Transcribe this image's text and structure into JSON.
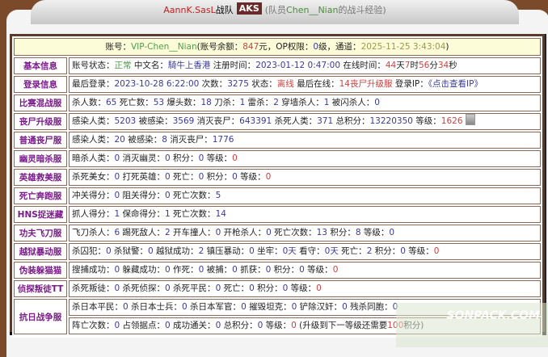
{
  "header": {
    "team": "AannK.SasL",
    "team_suffix": "战队",
    "logo": "AKS",
    "member_prefix": "(队员",
    "member": "Chen__Nian",
    "member_suffix": "的战斗经验)"
  },
  "account_line": [
    {
      "t": "账号：",
      "c": "k"
    },
    {
      "t": "VIP-Chen__Nian",
      "c": "g"
    },
    {
      "t": "(账号余额：",
      "c": "k"
    },
    {
      "t": "847",
      "c": "r"
    },
    {
      "t": "元，OP权限：",
      "c": "k"
    },
    {
      "t": "0",
      "c": "b"
    },
    {
      "t": "级，通道：",
      "c": "k"
    },
    {
      "t": "2025-11-25 3:43:04",
      "c": "o"
    },
    {
      "t": ")",
      "c": "k"
    }
  ],
  "rows": [
    {
      "label": "基本信息",
      "lines": [
        [
          {
            "t": "账号状态：",
            "c": "k"
          },
          {
            "t": "正常",
            "c": "g"
          },
          {
            "t": " 中文名：",
            "c": "k"
          },
          {
            "t": "騎牛上香港",
            "c": "b"
          },
          {
            "t": " 注册时间：",
            "c": "k"
          },
          {
            "t": "2023-01-12 0:47:00",
            "c": "b"
          },
          {
            "t": " 在线时间：",
            "c": "k"
          },
          {
            "t": "44",
            "c": "r"
          },
          {
            "t": "天",
            "c": "k"
          },
          {
            "t": "7",
            "c": "r"
          },
          {
            "t": "时",
            "c": "k"
          },
          {
            "t": "56",
            "c": "r"
          },
          {
            "t": "分",
            "c": "k"
          },
          {
            "t": "34",
            "c": "r"
          },
          {
            "t": "秒",
            "c": "k"
          }
        ]
      ]
    },
    {
      "label": "登录信息",
      "lines": [
        [
          {
            "t": "最后登录：",
            "c": "k"
          },
          {
            "t": "2023-10-28 6:22:00",
            "c": "b"
          },
          {
            "t": " 次数：",
            "c": "k"
          },
          {
            "t": "3275",
            "c": "b"
          },
          {
            "t": " 状态：",
            "c": "k"
          },
          {
            "t": "离线",
            "c": "r"
          },
          {
            "t": " 最后在线：",
            "c": "k"
          },
          {
            "t": "14丧尸升级服",
            "c": "r"
          },
          {
            "t": " 登录IP：",
            "c": "k"
          },
          {
            "t": "《点击查看IP》",
            "c": "b"
          }
        ]
      ]
    },
    {
      "label": "比赛混战服",
      "lines": [
        [
          {
            "t": "杀人数：",
            "c": "k"
          },
          {
            "t": "65",
            "c": "b"
          },
          {
            "t": " 死亡数：",
            "c": "k"
          },
          {
            "t": "53",
            "c": "b"
          },
          {
            "t": " 爆头数：",
            "c": "k"
          },
          {
            "t": "18",
            "c": "b"
          },
          {
            "t": " 刀杀：",
            "c": "k"
          },
          {
            "t": "1",
            "c": "b"
          },
          {
            "t": " 雷杀：",
            "c": "k"
          },
          {
            "t": "2",
            "c": "b"
          },
          {
            "t": " 穿墙杀人：",
            "c": "k"
          },
          {
            "t": "1",
            "c": "b"
          },
          {
            "t": " 被闪杀人：",
            "c": "k"
          },
          {
            "t": "0",
            "c": "b"
          }
        ]
      ]
    },
    {
      "label": "丧尸升级服",
      "avatar": true,
      "lines": [
        [
          {
            "t": "感染人类：",
            "c": "k"
          },
          {
            "t": "5203",
            "c": "b"
          },
          {
            "t": " 被感染：",
            "c": "k"
          },
          {
            "t": "3569",
            "c": "b"
          },
          {
            "t": " 消灭丧尸：",
            "c": "k"
          },
          {
            "t": "643391",
            "c": "b"
          },
          {
            "t": " 杀死人类：",
            "c": "k"
          },
          {
            "t": "371",
            "c": "b"
          },
          {
            "t": " 总积分：",
            "c": "k"
          },
          {
            "t": "13220350",
            "c": "b"
          },
          {
            "t": " 等级：",
            "c": "k"
          },
          {
            "t": "1626",
            "c": "r"
          }
        ]
      ]
    },
    {
      "label": "普通丧尸服",
      "lines": [
        [
          {
            "t": "感染人类：",
            "c": "k"
          },
          {
            "t": "20",
            "c": "b"
          },
          {
            "t": " 被感染：",
            "c": "k"
          },
          {
            "t": "8",
            "c": "b"
          },
          {
            "t": " 消灭丧尸：",
            "c": "k"
          },
          {
            "t": "1776",
            "c": "b"
          }
        ]
      ]
    },
    {
      "label": "幽灵暗杀服",
      "lines": [
        [
          {
            "t": "暗杀人类：",
            "c": "k"
          },
          {
            "t": "0",
            "c": "b"
          },
          {
            "t": " 消灭幽灵：",
            "c": "k"
          },
          {
            "t": "0",
            "c": "b"
          },
          {
            "t": " 积分：",
            "c": "k"
          },
          {
            "t": "0",
            "c": "b"
          },
          {
            "t": " 等级：",
            "c": "k"
          },
          {
            "t": "0",
            "c": "r"
          }
        ]
      ]
    },
    {
      "label": "英雄救美服",
      "lines": [
        [
          {
            "t": "杀死美女：",
            "c": "k"
          },
          {
            "t": "0",
            "c": "b"
          },
          {
            "t": " 打死英雄：",
            "c": "k"
          },
          {
            "t": "0",
            "c": "b"
          },
          {
            "t": " 死亡：",
            "c": "k"
          },
          {
            "t": "0",
            "c": "b"
          },
          {
            "t": " 积分：",
            "c": "k"
          },
          {
            "t": "0",
            "c": "b"
          },
          {
            "t": " 等级：",
            "c": "k"
          },
          {
            "t": "0",
            "c": "r"
          }
        ]
      ]
    },
    {
      "label": "死亡奔跑服",
      "lines": [
        [
          {
            "t": "冲关得分：",
            "c": "k"
          },
          {
            "t": "0",
            "c": "b"
          },
          {
            "t": " 阻关得分：",
            "c": "k"
          },
          {
            "t": "0",
            "c": "b"
          },
          {
            "t": " 死亡次数：",
            "c": "k"
          },
          {
            "t": "5",
            "c": "b"
          }
        ]
      ]
    },
    {
      "label": "HNS捉迷藏",
      "lines": [
        [
          {
            "t": "抓人得分：",
            "c": "k"
          },
          {
            "t": "1",
            "c": "b"
          },
          {
            "t": " 保命得分：",
            "c": "k"
          },
          {
            "t": "1",
            "c": "b"
          },
          {
            "t": " 死亡次数：",
            "c": "k"
          },
          {
            "t": "14",
            "c": "b"
          }
        ]
      ]
    },
    {
      "label": "功夫飞刀服",
      "lines": [
        [
          {
            "t": "飞刀杀人：",
            "c": "k"
          },
          {
            "t": "6",
            "c": "b"
          },
          {
            "t": " 踢死敌人：",
            "c": "k"
          },
          {
            "t": "2",
            "c": "b"
          },
          {
            "t": " 开车撞人：",
            "c": "k"
          },
          {
            "t": "0",
            "c": "b"
          },
          {
            "t": " 开枪杀人：",
            "c": "k"
          },
          {
            "t": "0",
            "c": "b"
          },
          {
            "t": " 死亡次数：",
            "c": "k"
          },
          {
            "t": "13",
            "c": "b"
          },
          {
            "t": " 积分：",
            "c": "k"
          },
          {
            "t": "8",
            "c": "b"
          },
          {
            "t": " 等级：",
            "c": "k"
          },
          {
            "t": "0",
            "c": "b"
          }
        ]
      ]
    },
    {
      "label": "越狱暴动服",
      "lines": [
        [
          {
            "t": "杀囚犯：",
            "c": "k"
          },
          {
            "t": "0",
            "c": "b"
          },
          {
            "t": " 杀狱警：",
            "c": "k"
          },
          {
            "t": "0",
            "c": "b"
          },
          {
            "t": " 越狱成功：",
            "c": "k"
          },
          {
            "t": "2",
            "c": "b"
          },
          {
            "t": " 镇压暴动：",
            "c": "k"
          },
          {
            "t": "0",
            "c": "b"
          },
          {
            "t": " 坐牢：",
            "c": "k"
          },
          {
            "t": "0天",
            "c": "b"
          },
          {
            "t": " 看守：",
            "c": "k"
          },
          {
            "t": "0天",
            "c": "b"
          },
          {
            "t": " 死亡：",
            "c": "k"
          },
          {
            "t": "2",
            "c": "b"
          },
          {
            "t": " 积分：",
            "c": "k"
          },
          {
            "t": "0",
            "c": "b"
          },
          {
            "t": " 等级：",
            "c": "k"
          },
          {
            "t": "0",
            "c": "r"
          }
        ]
      ]
    },
    {
      "label": "伪装躲猫猫",
      "lines": [
        [
          {
            "t": "搜捕成功：",
            "c": "k"
          },
          {
            "t": "0",
            "c": "b"
          },
          {
            "t": " 躲藏成功：",
            "c": "k"
          },
          {
            "t": "0",
            "c": "b"
          },
          {
            "t": " 作死：",
            "c": "k"
          },
          {
            "t": "0",
            "c": "b"
          },
          {
            "t": " 被捕：",
            "c": "k"
          },
          {
            "t": "0",
            "c": "b"
          },
          {
            "t": " 抓获：",
            "c": "k"
          },
          {
            "t": "0",
            "c": "b"
          },
          {
            "t": " 积分：",
            "c": "k"
          },
          {
            "t": "0",
            "c": "b"
          },
          {
            "t": " 等级：",
            "c": "k"
          },
          {
            "t": "0",
            "c": "r"
          }
        ]
      ]
    },
    {
      "label": "侦探叛徒TT",
      "lines": [
        [
          {
            "t": "杀死叛徒：",
            "c": "k"
          },
          {
            "t": "0",
            "c": "b"
          },
          {
            "t": " 杀死侦探：",
            "c": "k"
          },
          {
            "t": "0",
            "c": "b"
          },
          {
            "t": " 杀死平民：",
            "c": "k"
          },
          {
            "t": "0",
            "c": "b"
          },
          {
            "t": " 死亡：",
            "c": "k"
          },
          {
            "t": "0",
            "c": "b"
          },
          {
            "t": " 积分：",
            "c": "k"
          },
          {
            "t": "0",
            "c": "b"
          },
          {
            "t": " 等级：",
            "c": "k"
          },
          {
            "t": "0",
            "c": "r"
          }
        ]
      ]
    },
    {
      "label": "抗日战争服",
      "lines": [
        [
          {
            "t": "杀日本平民：",
            "c": "k"
          },
          {
            "t": "0",
            "c": "b"
          },
          {
            "t": " 杀日本士兵：",
            "c": "k"
          },
          {
            "t": "0",
            "c": "b"
          },
          {
            "t": " 杀日本军官：",
            "c": "k"
          },
          {
            "t": "0",
            "c": "b"
          },
          {
            "t": " 摧毁坦克：",
            "c": "k"
          },
          {
            "t": "0",
            "c": "b"
          },
          {
            "t": " 铲除汉奸：",
            "c": "k"
          },
          {
            "t": "0",
            "c": "b"
          },
          {
            "t": " 残杀同胞：",
            "c": "k"
          },
          {
            "t": "0",
            "c": "b"
          }
        ],
        [
          {
            "t": "阵亡次数：",
            "c": "k"
          },
          {
            "t": "0",
            "c": "b"
          },
          {
            "t": " 占领据点：",
            "c": "k"
          },
          {
            "t": "0",
            "c": "b"
          },
          {
            "t": " 成功通关：",
            "c": "k"
          },
          {
            "t": "0",
            "c": "b"
          },
          {
            "t": " 总积分：",
            "c": "k"
          },
          {
            "t": "0",
            "c": "b"
          },
          {
            "t": " 等级：",
            "c": "k"
          },
          {
            "t": "0",
            "c": "r"
          },
          {
            "t": " (升级到下一等级还需要",
            "c": "k"
          },
          {
            "t": "100",
            "c": "r"
          },
          {
            "t": "积分)",
            "c": "k"
          }
        ]
      ]
    }
  ],
  "watermark": "SONPACK.COM"
}
